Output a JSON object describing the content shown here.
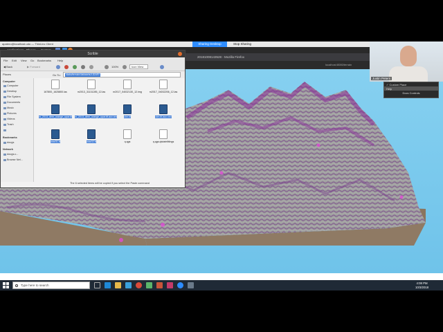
{
  "remote_session": {
    "window_title": "apatero@localhost.udu — ThinLinc Client",
    "share_label": "Sharing Desktop",
    "stop_label": "Stop Sharing"
  },
  "panel": {
    "menus": [
      "Applications",
      "Places",
      "System"
    ]
  },
  "terrain_app": {
    "title": "20181008143528 - Mozilla Firefox",
    "url": "localhost:8080/terrain",
    "colors": {
      "sky": "#86d0f0",
      "terrain_side": "#8f7a64",
      "contour": "#8a2f9a"
    }
  },
  "file_manager": {
    "title": "Scrible",
    "menu": [
      "File",
      "Edit",
      "View",
      "Go",
      "Bookmarks",
      "Help"
    ],
    "toolbar": {
      "back": "Back",
      "forward": "Forward",
      "zoom": "100%",
      "view_mode": "Icon View"
    },
    "goto_label": "Go To:",
    "path": "/data/terrain/datasets/LiDAR/",
    "places_header": "Places",
    "sidebar": {
      "computer_header": "Computer",
      "computer_items": [
        "Computer",
        "Desktop",
        "File System",
        "Documents",
        "Music",
        "Pictures",
        "Videos",
        "Trash"
      ],
      "bookmarks_header": "Bookmarks",
      "bookmark_items": [
        "dougs"
      ],
      "network_header": "Network",
      "network_items": [
        "dougs.c...",
        "Browse Net..."
      ]
    },
    "files": [
      {
        "name": "167800_1625800.las",
        "kind": "doc",
        "selected": false
      },
      {
        "name": "m2013_31131285_12.las",
        "kind": "doc",
        "selected": false
      },
      {
        "name": "m2017_04032130_12.img",
        "kind": "doc",
        "selected": false
      },
      {
        "name": "m2017_04032206_12.las",
        "kind": "doc",
        "selected": false
      },
      {
        "name": "m_2013_dem_orange_upar.tif",
        "kind": "img",
        "selected": true
      },
      {
        "name": "m_2013_dem_orange_upar.tif.aux.xml",
        "kind": "img",
        "selected": true
      },
      {
        "name": "utm.tif",
        "kind": "img",
        "selected": true
      },
      {
        "name": "utm.tif.aux.xml",
        "kind": "img",
        "selected": true
      },
      {
        "name": "pear01.tif",
        "kind": "img",
        "selected": true
      },
      {
        "name": "pear02.tif",
        "kind": "img",
        "selected": true
      },
      {
        "name": "q.qgs",
        "kind": "doc",
        "selected": false
      },
      {
        "name": "q.qgs.qlstatelittings",
        "kind": "doc",
        "selected": false
      }
    ],
    "status": "The 6 selected items will be copied if you select the Paste command"
  },
  "webcam": {
    "name": "Justin Peters",
    "menu_items": [
      "✓ Custom Place",
      "Help",
      "Docs Controls"
    ]
  },
  "taskbar": {
    "search_placeholder": "Type here to search",
    "time": "4:08 PM",
    "date": "10/3/2018",
    "colors": {
      "bar": "#1f2a36",
      "edge": "#1e88d6",
      "explorer": "#e8b84a",
      "chrome": "#d94a3a",
      "zoom": "#2d8cff"
    }
  }
}
